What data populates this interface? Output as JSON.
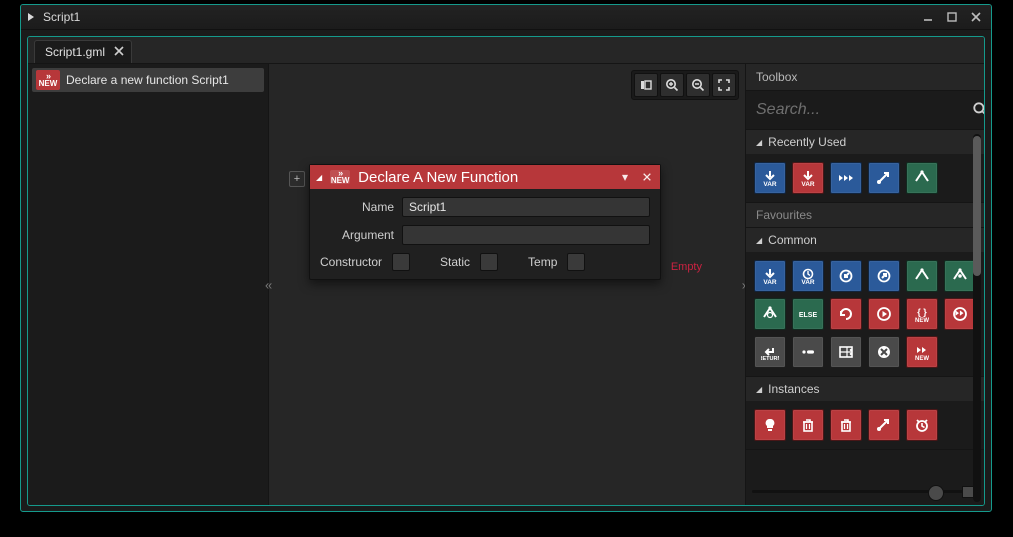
{
  "window": {
    "title": "Script1"
  },
  "tabs": [
    {
      "label": "Script1.gml"
    }
  ],
  "tree": {
    "item_label": "Declare a new function Script1"
  },
  "canvas": {
    "handle_left": "«",
    "handle_right": "»",
    "add_label": "+"
  },
  "func_node": {
    "title": "Declare A New Function",
    "fields": {
      "name_label": "Name",
      "name_value": "Script1",
      "argument_label": "Argument",
      "argument_value": ""
    },
    "checks": {
      "constructor": "Constructor",
      "static": "Static",
      "temp": "Temp"
    },
    "empty_label": "Empty"
  },
  "toolbox": {
    "title": "Toolbox",
    "search_placeholder": "Search...",
    "sections": {
      "recently_used": "Recently Used",
      "favourites": "Favourites",
      "common": "Common",
      "instances": "Instances"
    },
    "recently_used_items": [
      {
        "name": "assign-variable",
        "color": "blue",
        "glyph": "var-down"
      },
      {
        "name": "assign-variable-red",
        "color": "red",
        "glyph": "var-down"
      },
      {
        "name": "play",
        "color": "blue",
        "glyph": "play3"
      },
      {
        "name": "jump-to-point",
        "color": "blue",
        "glyph": "arrow-dot"
      },
      {
        "name": "branch",
        "color": "green",
        "glyph": "branch"
      }
    ],
    "common_items": [
      {
        "name": "assign-variable",
        "color": "blue",
        "glyph": "var-down"
      },
      {
        "name": "timer-variable",
        "color": "blue",
        "glyph": "clock-var"
      },
      {
        "name": "link-in",
        "color": "blue",
        "glyph": "link-in"
      },
      {
        "name": "link-out",
        "color": "blue",
        "glyph": "link-out"
      },
      {
        "name": "branch",
        "color": "green",
        "glyph": "branch"
      },
      {
        "name": "branch-check",
        "color": "green",
        "glyph": "branch-dot"
      },
      {
        "name": "branch-settings",
        "color": "green",
        "glyph": "branch-gear"
      },
      {
        "name": "else",
        "color": "green",
        "glyph": "else"
      },
      {
        "name": "loop",
        "color": "red",
        "glyph": "loop"
      },
      {
        "name": "run",
        "color": "red",
        "glyph": "run"
      },
      {
        "name": "new-block",
        "color": "red",
        "glyph": "new-braces"
      },
      {
        "name": "next",
        "color": "red",
        "glyph": "next"
      },
      {
        "name": "return",
        "color": "grey",
        "glyph": "return"
      },
      {
        "name": "comment",
        "color": "grey",
        "glyph": "comment"
      },
      {
        "name": "list",
        "color": "grey",
        "glyph": "list"
      },
      {
        "name": "cancel",
        "color": "grey",
        "glyph": "cancel"
      },
      {
        "name": "new-function",
        "color": "red",
        "glyph": "new-fn"
      }
    ],
    "instances_items": [
      {
        "name": "light",
        "color": "red",
        "glyph": "bulb"
      },
      {
        "name": "delete",
        "color": "red",
        "glyph": "trash"
      },
      {
        "name": "delete-all",
        "color": "red",
        "glyph": "trash"
      },
      {
        "name": "connect",
        "color": "red",
        "glyph": "arrow-dot"
      },
      {
        "name": "alarm",
        "color": "red",
        "glyph": "alarm"
      }
    ]
  }
}
